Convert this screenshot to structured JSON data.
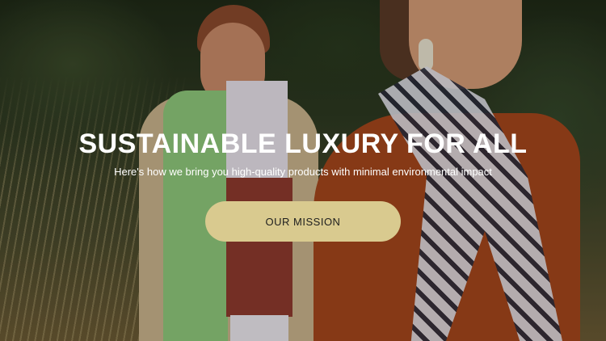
{
  "hero": {
    "title": "SUSTAINABLE LUXURY FOR ALL",
    "subtitle": "Here's how we bring you high-quality products with minimal environmental impact",
    "cta_label": "OUR MISSION"
  },
  "colors": {
    "cta_background": "#d9ca8f",
    "title_text": "#ffffff",
    "cta_text": "#1e1e1e"
  }
}
